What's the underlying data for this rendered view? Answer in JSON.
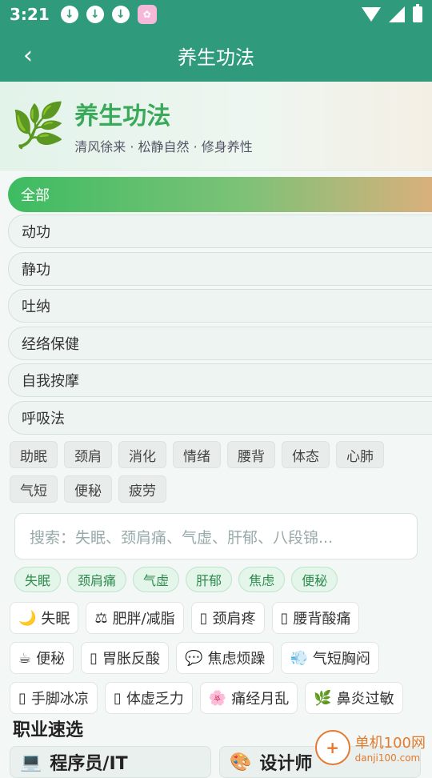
{
  "status": {
    "time": "3:21",
    "downloads": [
      "download-icon",
      "download-icon",
      "download-icon"
    ]
  },
  "appbar": {
    "title": "养生功法"
  },
  "hero": {
    "title": "养生功法",
    "subtitle": "清风徐来 · 松静自然 · 修身养性",
    "leaf": "🌿"
  },
  "categories": [
    "全部",
    "动功",
    "静功",
    "吐纳",
    "经络保健",
    "自我按摩",
    "呼吸法"
  ],
  "tags": [
    "助眠",
    "颈肩",
    "消化",
    "情绪",
    "腰背",
    "体态",
    "心肺",
    "气短",
    "便秘",
    "疲劳"
  ],
  "search": {
    "placeholder": "搜索：失眠、颈肩痛、气虚、肝郁、八段锦..."
  },
  "chips": [
    "失眠",
    "颈肩痛",
    "气虚",
    "肝郁",
    "焦虑",
    "便秘"
  ],
  "symptoms": [
    {
      "icon": "🌙",
      "label": "失眠"
    },
    {
      "icon": "⚖",
      "label": "肥胖/减脂"
    },
    {
      "icon": "▯",
      "label": "颈肩疼"
    },
    {
      "icon": "▯",
      "label": "腰背酸痛"
    },
    {
      "icon": "☕",
      "label": "便秘"
    },
    {
      "icon": "▯",
      "label": "胃胀反酸"
    },
    {
      "icon": "💬",
      "label": "焦虑烦躁"
    },
    {
      "icon": "💨",
      "label": "气短胸闷"
    },
    {
      "icon": "▯",
      "label": "手脚冰凉"
    },
    {
      "icon": "▯",
      "label": "体虚乏力"
    },
    {
      "icon": "🌸",
      "label": "痛经月乱"
    },
    {
      "icon": "🌿",
      "label": "鼻炎过敏"
    }
  ],
  "section": {
    "title": "职业速选"
  },
  "jobs": [
    {
      "icon": "💻",
      "label": "程序员/IT"
    },
    {
      "icon": "🎨",
      "label": "设计师"
    }
  ],
  "watermark": {
    "site": "单机100网",
    "url": "danji100.com"
  },
  "colors": {
    "primary": "#2f9b7c",
    "accent_green": "#3aa95a"
  }
}
